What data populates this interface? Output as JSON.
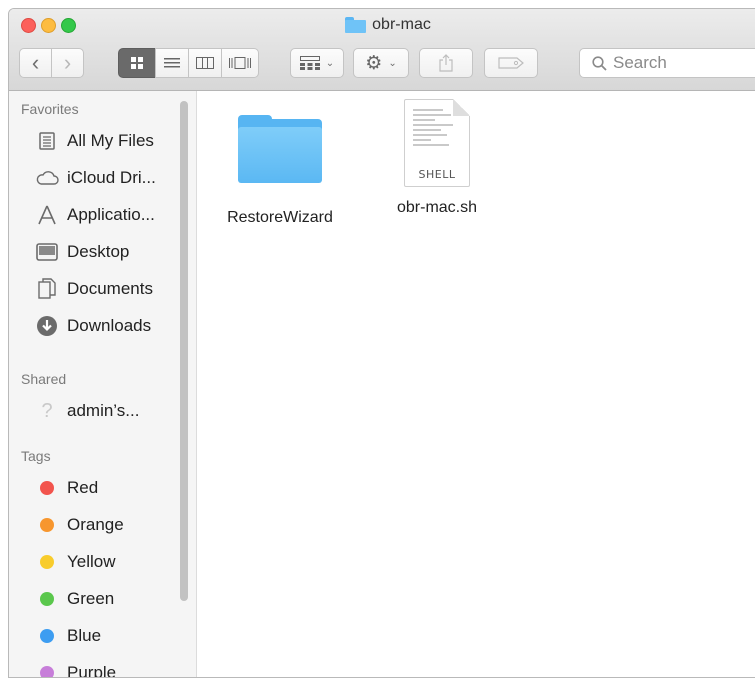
{
  "window": {
    "title": "obr-mac"
  },
  "toolbar": {
    "back_label": "‹",
    "forward_label": "›",
    "search_placeholder": "Search"
  },
  "sidebar": {
    "favorites_heading": "Favorites",
    "favorites": [
      {
        "label": "All My Files",
        "icon": "all-files-icon"
      },
      {
        "label": "iCloud Dri...",
        "icon": "cloud-icon"
      },
      {
        "label": "Applicatio...",
        "icon": "applications-icon"
      },
      {
        "label": "Desktop",
        "icon": "desktop-icon"
      },
      {
        "label": "Documents",
        "icon": "documents-icon"
      },
      {
        "label": "Downloads",
        "icon": "downloads-icon"
      }
    ],
    "shared_heading": "Shared",
    "shared": [
      {
        "label": "admin’s...",
        "icon": "question-icon"
      }
    ],
    "tags_heading": "Tags",
    "tags": [
      {
        "label": "Red",
        "color": "#f2544d"
      },
      {
        "label": "Orange",
        "color": "#f7962e"
      },
      {
        "label": "Yellow",
        "color": "#f8cc2c"
      },
      {
        "label": "Green",
        "color": "#5ac74c"
      },
      {
        "label": "Blue",
        "color": "#3d9df1"
      },
      {
        "label": "Purple",
        "color": "#c77ed9"
      }
    ]
  },
  "files": [
    {
      "name": "RestoreWizard",
      "kind": "folder"
    },
    {
      "name": "obr-mac.sh",
      "kind": "shell-script",
      "badge": "SHELL"
    }
  ]
}
